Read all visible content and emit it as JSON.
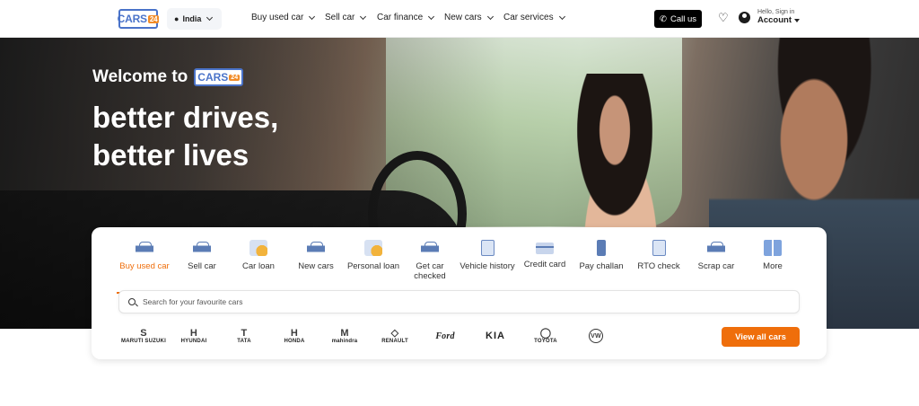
{
  "header": {
    "logo_text": "CARS",
    "logo_num": "24",
    "location": "India",
    "nav": [
      "Buy used car",
      "Sell car",
      "Car finance",
      "New cars",
      "Car services"
    ],
    "call_label": "Call us",
    "account_hello": "Hello, Sign in",
    "account_label": "Account"
  },
  "hero": {
    "welcome": "Welcome to",
    "line1": "better drives,",
    "line2": "better lives"
  },
  "services": [
    {
      "label": "Buy used car",
      "icon": "car-icon",
      "active": true
    },
    {
      "label": "Sell car",
      "icon": "car-sell-icon"
    },
    {
      "label": "Car loan",
      "icon": "loan-icon"
    },
    {
      "label": "New cars",
      "icon": "new-car-icon"
    },
    {
      "label": "Personal loan",
      "icon": "personal-loan-icon"
    },
    {
      "label": "Get car checked",
      "icon": "car-inspection-icon"
    },
    {
      "label": "Vehicle history",
      "icon": "history-icon"
    },
    {
      "label": "Credit card",
      "icon": "credit-card-icon"
    },
    {
      "label": "Pay challan",
      "icon": "phone-icon"
    },
    {
      "label": "RTO check",
      "icon": "rto-icon"
    },
    {
      "label": "Scrap car",
      "icon": "scrap-car-icon"
    },
    {
      "label": "More",
      "icon": "grid-icon"
    }
  ],
  "search": {
    "placeholder": "Search for your favourite cars"
  },
  "brands": [
    "MARUTI SUZUKI",
    "HYUNDAI",
    "TATA",
    "HONDA",
    "mahindra",
    "RENAULT",
    "Ford",
    "KIA",
    "TOYOTA",
    "VW"
  ],
  "view_all": "View all cars",
  "colors": {
    "accent": "#ef6e0b",
    "brand_blue": "#4a73c9"
  }
}
